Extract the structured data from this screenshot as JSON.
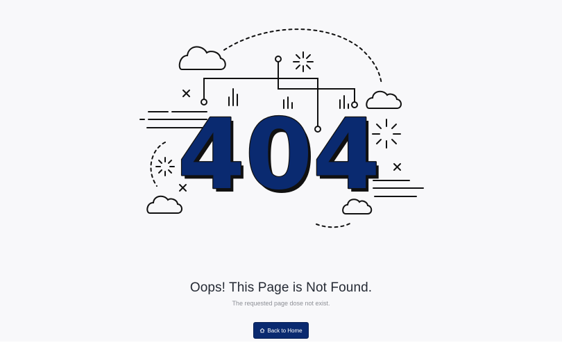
{
  "error": {
    "code": "404",
    "title": "Oops! This Page is Not Found.",
    "message": "The requested page dose not exist."
  },
  "actions": {
    "back_home_label": "Back to Home",
    "back_home_icon": "home-icon"
  },
  "colors": {
    "digit_fill": "#0a2a70",
    "button_bg": "#0a2a70",
    "background": "#f8f8fa",
    "line_art": "#111111"
  }
}
